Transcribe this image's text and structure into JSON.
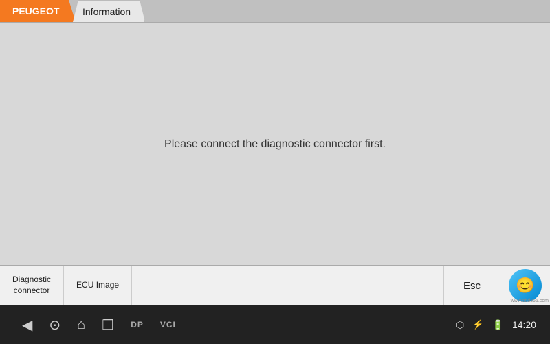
{
  "header": {
    "brand_label": "PEUGEOT",
    "tab_label": "Information"
  },
  "main": {
    "message": "Please connect the diagnostic connector first."
  },
  "action_bar": {
    "btn1_line1": "Diagnostic",
    "btn1_line2": "connector",
    "btn2_label": "ECU Image",
    "esc_label": "Esc"
  },
  "logo": {
    "symbol": "😊",
    "watermark": "www.obd365.com"
  },
  "nav_bar": {
    "back_icon": "◀",
    "camera_icon": "⊙",
    "home_icon": "⌂",
    "copy_icon": "❐",
    "dp_label": "DP",
    "vci_label": "VCI",
    "status_icons": "🔷🔵",
    "time": "14:20"
  }
}
